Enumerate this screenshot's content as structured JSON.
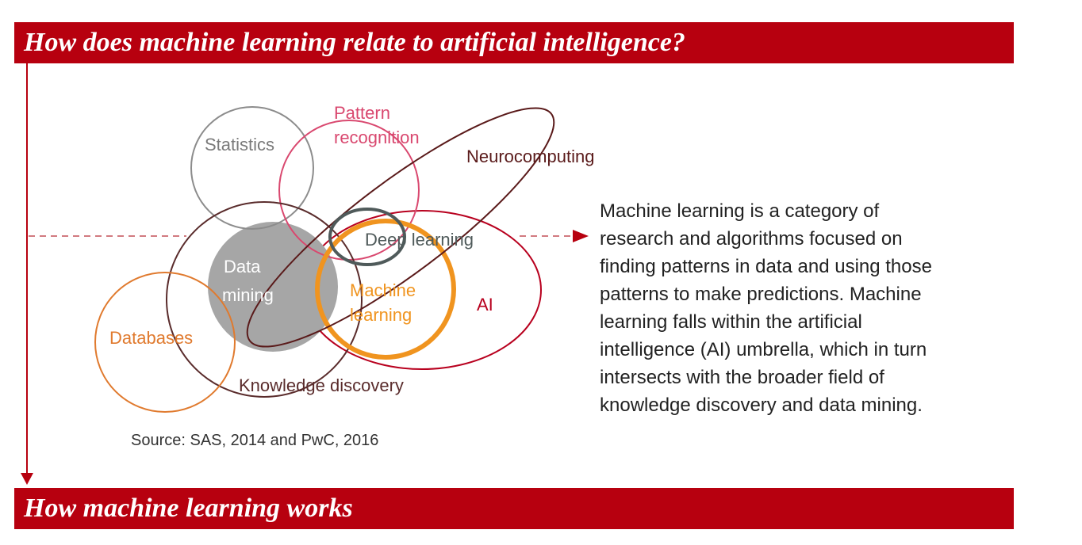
{
  "headings": {
    "top": "How does machine learning relate to artificial intelligence?",
    "bottom": "How machine learning works"
  },
  "diagram": {
    "labels": {
      "statistics": "Statistics",
      "pattern_recognition_line1": "Pattern",
      "pattern_recognition_line2": "recognition",
      "neurocomputing": "Neurocomputing",
      "deep_learning": "Deep learning",
      "data_mining_line1": "Data",
      "data_mining_line2": "mining",
      "machine_learning_line1": "Machine",
      "machine_learning_line2": "learning",
      "ai": "AI",
      "databases": "Databases",
      "knowledge_discovery": "Knowledge discovery"
    },
    "colors": {
      "accent_red": "#b7000f",
      "statistics": "#8c8c8c",
      "pattern_recognition": "#d9486f",
      "neurocomputing": "#5a1a1a",
      "deep_learning": "#4f5a5a",
      "data_mining_fill": "#a6a6a6",
      "machine_learning": "#f0941f",
      "ai": "#b8001e",
      "databases": "#e07a2e",
      "knowledge_discovery": "#5a2c2c"
    }
  },
  "description": "Machine learning is a category of\nresearch and algorithms focused on\nfinding patterns in data and using those\npatterns to make predictions. Machine\nlearning falls within the artificial\nintelligence (AI) umbrella, which in turn\nintersects with the broader field of\nknowledge discovery and data mining.",
  "source": "Source: SAS, 2014 and PwC, 2016"
}
